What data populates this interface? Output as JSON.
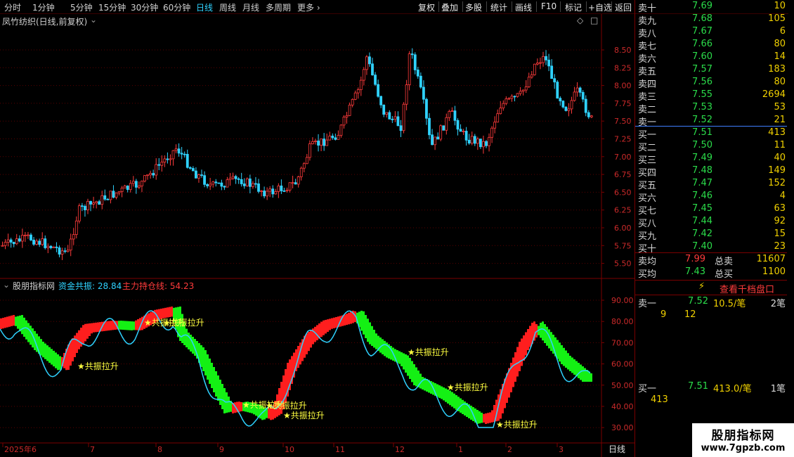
{
  "toolbar": {
    "periods": [
      "分时",
      "1分钟",
      "5分钟",
      "15分钟",
      "30分钟",
      "60分钟",
      "日线",
      "周线",
      "月线",
      "多周期",
      "更多"
    ],
    "active_period": "日线",
    "buttons": [
      "复权",
      "叠加",
      "多股",
      "统计",
      "画线",
      "F10",
      "标记",
      "+自选",
      "返回"
    ]
  },
  "main_chart": {
    "title": "凤竹纺织(日线,前复权)",
    "price_ticks": [
      "8.50",
      "8.25",
      "8.00",
      "7.75",
      "7.50",
      "7.25",
      "7.00",
      "6.75",
      "6.50",
      "6.25",
      "6.00",
      "5.75",
      "5.50"
    ]
  },
  "indicator": {
    "name": "股朋指标网",
    "line1_label": "资金共振: 28.84",
    "line2_label": "主力持仓线: 54.23",
    "ticks": [
      "90.00",
      "80.00",
      "70.00",
      "60.00",
      "50.00",
      "40.00",
      "30.00"
    ],
    "signal_label": "共振拉升"
  },
  "date_axis": {
    "labels": [
      "2025年6",
      "7",
      "8",
      "9",
      "10",
      "11",
      "12",
      "1",
      "2",
      "3"
    ],
    "period_label": "日线"
  },
  "order_book": {
    "sells": [
      {
        "label": "卖十",
        "price": "7.69",
        "volume": "10"
      },
      {
        "label": "卖九",
        "price": "7.68",
        "volume": "105"
      },
      {
        "label": "卖八",
        "price": "7.67",
        "volume": "6"
      },
      {
        "label": "卖七",
        "price": "7.66",
        "volume": "80"
      },
      {
        "label": "卖六",
        "price": "7.60",
        "volume": "14"
      },
      {
        "label": "卖五",
        "price": "7.57",
        "volume": "183"
      },
      {
        "label": "卖四",
        "price": "7.56",
        "volume": "80"
      },
      {
        "label": "卖三",
        "price": "7.55",
        "volume": "2694"
      },
      {
        "label": "卖二",
        "price": "7.53",
        "volume": "53"
      },
      {
        "label": "卖一",
        "price": "7.52",
        "volume": "21"
      }
    ],
    "buys": [
      {
        "label": "买一",
        "price": "7.51",
        "volume": "413"
      },
      {
        "label": "买二",
        "price": "7.50",
        "volume": "11"
      },
      {
        "label": "买三",
        "price": "7.49",
        "volume": "40"
      },
      {
        "label": "买四",
        "price": "7.48",
        "volume": "149"
      },
      {
        "label": "买五",
        "price": "7.47",
        "volume": "152"
      },
      {
        "label": "买六",
        "price": "7.46",
        "volume": "4"
      },
      {
        "label": "买七",
        "price": "7.45",
        "volume": "63"
      },
      {
        "label": "买八",
        "price": "7.44",
        "volume": "92"
      },
      {
        "label": "买九",
        "price": "7.42",
        "volume": "15"
      },
      {
        "label": "买十",
        "price": "7.40",
        "volume": "23"
      }
    ],
    "sell_avg": {
      "label": "卖均",
      "price": "7.99",
      "total_label": "总卖",
      "total": "11607"
    },
    "buy_avg": {
      "label": "买均",
      "price": "7.43",
      "total_label": "总买",
      "total": "1100"
    },
    "depth_button": "查看千档盘口",
    "sell1_detail": {
      "label": "卖一",
      "price": "7.52",
      "avg": "10.5/笔",
      "count": "2笔",
      "q1": "9",
      "q2": "12"
    },
    "buy1_detail": {
      "label": "买一",
      "price": "7.51",
      "avg": "413.0/笔",
      "count": "1笔",
      "q1": "413"
    }
  },
  "watermark": {
    "line1": "股朋指标网",
    "line2": "www.7gpzb.com"
  },
  "colors": {
    "up": "#ff3b3b",
    "down": "#2bdc4a",
    "cyan": "#2fd2ff",
    "yellow": "#f0d000",
    "grid": "#5a0000"
  }
}
